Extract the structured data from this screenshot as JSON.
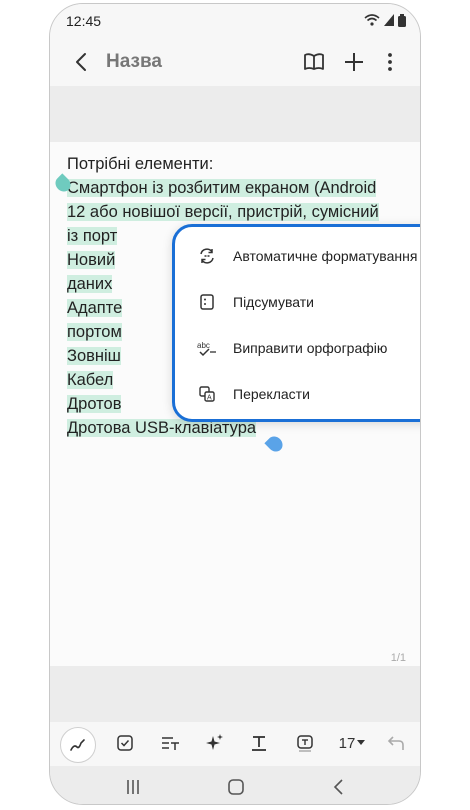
{
  "statusbar": {
    "time": "12:45"
  },
  "appbar": {
    "title": "Назва"
  },
  "note": {
    "lines": [
      "Потрібні елементи:",
      "Смартфон із розбитим екраном (Android",
      "12 або новішої версії, пристрій, сумісний",
      "із порт",
      "Новий",
      "даних",
      "Адапте",
      "портом",
      "Зовніш",
      "Кабел",
      "Дротов",
      "Дротова USB-клавіатура"
    ],
    "page_indicator": "1/1"
  },
  "context_menu": {
    "items": [
      {
        "label": "Автоматичне форматування",
        "icon": "auto-format-icon"
      },
      {
        "label": "Підсумувати",
        "icon": "summary-icon"
      },
      {
        "label": "Виправити орфографію",
        "icon": "spellcheck-icon"
      },
      {
        "label": "Перекласти",
        "icon": "translate-icon"
      }
    ]
  },
  "toolbar": {
    "font_size": "17"
  },
  "colors": {
    "highlight": "#cfeee0",
    "accent": "#1a6fd6",
    "left_handle": "#6fcbbf",
    "right_handle": "#5aa3e8"
  }
}
